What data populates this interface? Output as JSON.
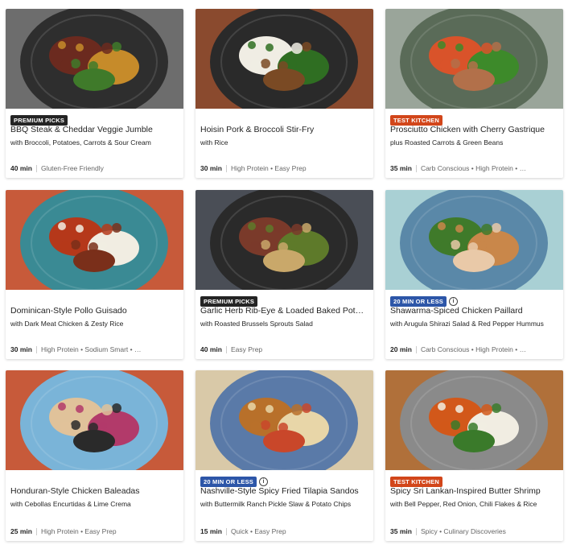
{
  "recipes": [
    {
      "badge": "PREMIUM PICKS",
      "badge_style": "dark",
      "info_icon": false,
      "title": "BBQ Steak & Cheddar Veggie Jumble",
      "subtitle": "with Broccoli, Potatoes, Carrots & Sour Cream",
      "time": "40 min",
      "tags": "Gluten-Free Friendly",
      "plate": "#2e2e2e",
      "bg": "#6d6d6d",
      "food": [
        "#6b2a1f",
        "#c68b2a",
        "#3f7a2a"
      ]
    },
    {
      "badge": "",
      "badge_style": "",
      "info_icon": false,
      "title": "Hoisin Pork & Broccoli Stir-Fry",
      "subtitle": "with Rice",
      "time": "30 min",
      "tags": "High Protein • Easy Prep",
      "plate": "#2a2a2a",
      "bg": "#8a4a2e",
      "food": [
        "#f0ede4",
        "#2f6e22",
        "#7a4a24"
      ]
    },
    {
      "badge": "TEST KITCHEN",
      "badge_style": "orange",
      "info_icon": false,
      "title": "Prosciutto Chicken with Cherry Gastrique",
      "subtitle": "plus Roasted Carrots & Green Beans",
      "time": "35 min",
      "tags": "Carb Conscious • High Protein • …",
      "plate": "#5a6b58",
      "bg": "#9aa59a",
      "food": [
        "#d9532a",
        "#3d8a2a",
        "#b2704a"
      ]
    },
    {
      "badge": "",
      "badge_style": "",
      "info_icon": false,
      "title": "Dominican-Style Pollo Guisado",
      "subtitle": "with Dark Meat Chicken & Zesty Rice",
      "time": "30 min",
      "tags": "High Protein • Sodium Smart • …",
      "plate": "#3a8a94",
      "bg": "#c75a3a",
      "food": [
        "#b5381a",
        "#f1ede2",
        "#7a2f1a"
      ]
    },
    {
      "badge": "PREMIUM PICKS",
      "badge_style": "dark",
      "info_icon": false,
      "title": "Garlic Herb Rib-Eye & Loaded Baked Pot…",
      "subtitle": "with Roasted Brussels Sprouts Salad",
      "time": "40 min",
      "tags": "Easy Prep",
      "plate": "#2a2a2a",
      "bg": "#4a4e56",
      "food": [
        "#7a3a2a",
        "#5e7a2a",
        "#c9a86a"
      ]
    },
    {
      "badge": "20 MIN OR LESS",
      "badge_style": "blue",
      "info_icon": true,
      "title": "Shawarma-Spiced Chicken Paillard",
      "subtitle": "with Arugula Shirazi Salad & Red Pepper Hummus",
      "time": "20 min",
      "tags": "Carb Conscious • High Protein • …",
      "plate": "#5a88a8",
      "bg": "#a9d0d4",
      "food": [
        "#3f7a2a",
        "#c9874a",
        "#e9c9a8"
      ]
    },
    {
      "badge": "",
      "badge_style": "",
      "info_icon": false,
      "title": "Honduran-Style Chicken Baleadas",
      "subtitle": "with Cebollas Encurtidas & Lime Crema",
      "time": "25 min",
      "tags": "High Protein • Easy Prep",
      "plate": "#7ab4d8",
      "bg": "#c75a3a",
      "food": [
        "#e0c29a",
        "#b23a6a",
        "#2a2a2a"
      ]
    },
    {
      "badge": "20 MIN OR LESS",
      "badge_style": "blue",
      "info_icon": true,
      "title": "Nashville-Style Spicy Fried Tilapia Sandos",
      "subtitle": "with Buttermilk Ranch Pickle Slaw & Potato Chips",
      "time": "15 min",
      "tags": "Quick • Easy Prep",
      "plate": "#5a7aa8",
      "bg": "#d9c9a8",
      "food": [
        "#b8702a",
        "#e8d6a8",
        "#c9472a"
      ]
    },
    {
      "badge": "TEST KITCHEN",
      "badge_style": "orange",
      "info_icon": false,
      "title": "Spicy Sri Lankan-Inspired Butter Shrimp",
      "subtitle": "with Bell Pepper, Red Onion, Chili Flakes & Rice",
      "time": "35 min",
      "tags": "Spicy • Culinary Discoveries",
      "plate": "#8a8a8a",
      "bg": "#b0703a",
      "food": [
        "#d2581a",
        "#f1ede2",
        "#3a7a2a"
      ]
    }
  ]
}
